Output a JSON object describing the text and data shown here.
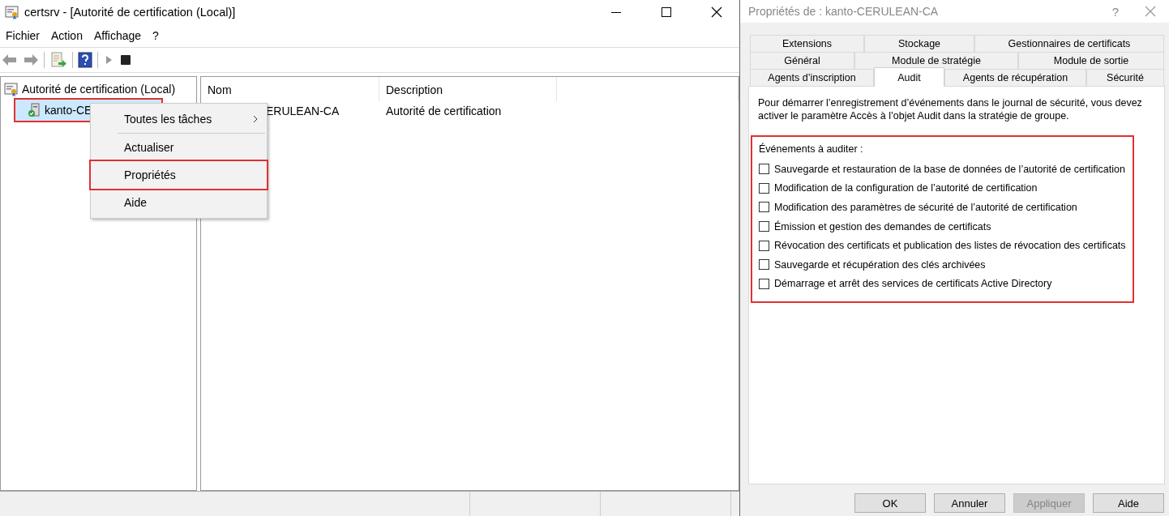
{
  "main_window": {
    "title": "certsrv - [Autorité de certification (Local)]",
    "menu": [
      "Fichier",
      "Action",
      "Affichage",
      "?"
    ],
    "tree": [
      {
        "label": "Autorité de certification (Local)",
        "selected": false,
        "highlighted": false,
        "children": [
          {
            "label": "kanto-CE",
            "selected": true,
            "highlighted": true
          }
        ]
      }
    ],
    "list": {
      "columns": [
        "Nom",
        "Description"
      ],
      "rows": [
        [
          "ERULEAN-CA",
          "Autorité de certification"
        ]
      ]
    },
    "context_menu": [
      {
        "label": "Toutes les tâches",
        "kind": "submenu",
        "highlighted": false
      },
      {
        "label": "Actualiser",
        "kind": "item",
        "highlighted": false
      },
      {
        "label": "Propriétés",
        "kind": "item",
        "highlighted": true
      },
      {
        "label": "Aide",
        "kind": "item",
        "highlighted": false
      }
    ]
  },
  "dialog": {
    "title": "Propriétés de : kanto-CERULEAN-CA",
    "help_button": "?",
    "tab_rows": [
      [
        {
          "label": "Extensions",
          "selected": false
        },
        {
          "label": "Stockage",
          "selected": false
        },
        {
          "label": "Gestionnaires de certificats",
          "selected": false
        }
      ],
      [
        {
          "label": "Général",
          "selected": false
        },
        {
          "label": "Module de stratégie",
          "selected": false
        },
        {
          "label": "Module de sortie",
          "selected": false
        }
      ],
      [
        {
          "label": "Agents d’inscription",
          "selected": false
        },
        {
          "label": "Audit",
          "selected": true
        },
        {
          "label": "Agents de récupération",
          "selected": false
        },
        {
          "label": "Sécurité",
          "selected": false
        }
      ]
    ],
    "description": "Pour démarrer l’enregistrement d’événements dans le journal de sécurité, vous devez activer le paramètre Accès à l’objet Audit dans la stratégie de groupe.",
    "events": {
      "label": "Événements à auditer :",
      "highlighted": true,
      "items": [
        {
          "label": "Sauvegarde et restauration de la base de données de l’autorité de certification",
          "checked": false
        },
        {
          "label": "Modification de la configuration de l’autorité de certification",
          "checked": false
        },
        {
          "label": "Modification des paramètres de sécurité de l’autorité de certification",
          "checked": false
        },
        {
          "label": "Émission et gestion des demandes de certificats",
          "checked": false
        },
        {
          "label": "Révocation des certificats et publication des listes de révocation des certificats",
          "checked": false
        },
        {
          "label": "Sauvegarde et récupération des clés archivées",
          "checked": false
        },
        {
          "label": "Démarrage et arrêt des services de certificats Active Directory",
          "checked": false
        }
      ]
    },
    "buttons": [
      {
        "label": "OK",
        "disabled": false
      },
      {
        "label": "Annuler",
        "disabled": false
      },
      {
        "label": "Appliquer",
        "disabled": true
      },
      {
        "label": "Aide",
        "disabled": false
      }
    ]
  }
}
